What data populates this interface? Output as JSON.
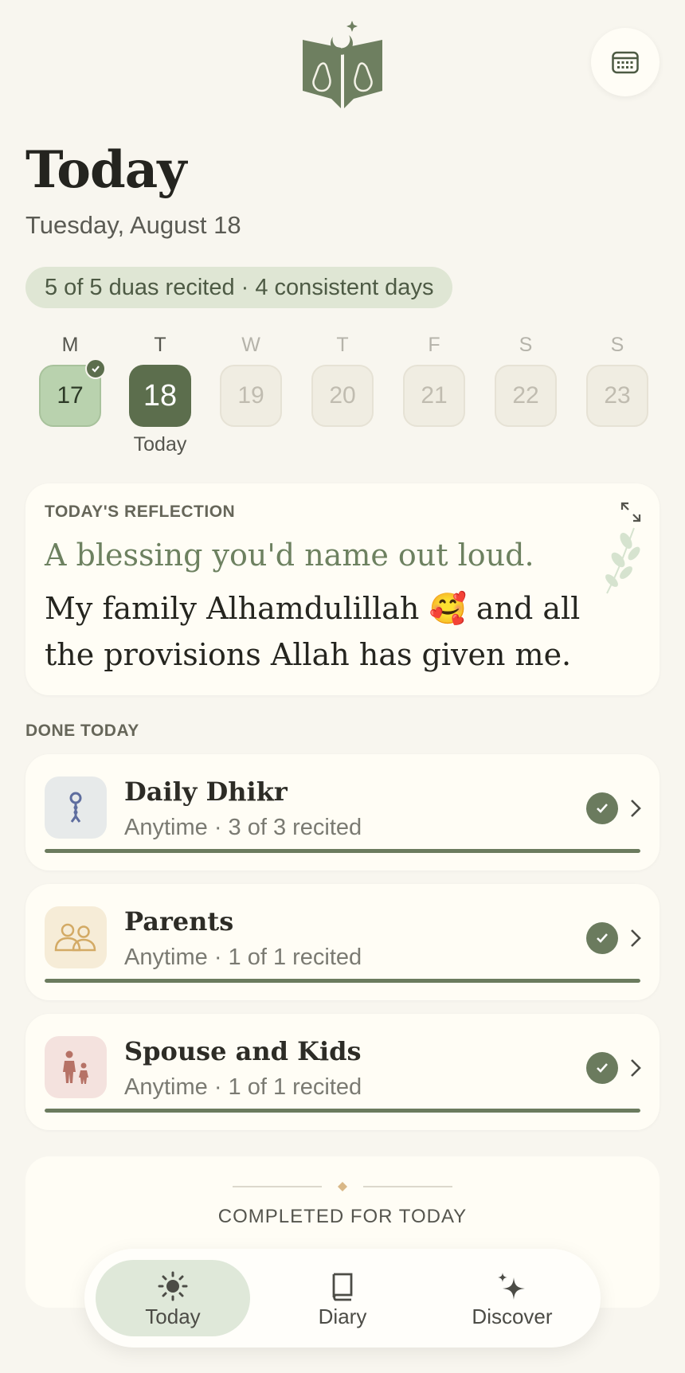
{
  "header": {
    "title": "Today",
    "date": "Tuesday, August 18",
    "stats": "5 of 5 duas recited · 4 consistent days"
  },
  "week": {
    "days": [
      {
        "letter": "M",
        "num": "17",
        "state": "done"
      },
      {
        "letter": "T",
        "num": "18",
        "state": "today",
        "sub": "Today"
      },
      {
        "letter": "W",
        "num": "19",
        "state": "future"
      },
      {
        "letter": "T",
        "num": "20",
        "state": "future"
      },
      {
        "letter": "F",
        "num": "21",
        "state": "future"
      },
      {
        "letter": "S",
        "num": "22",
        "state": "future"
      },
      {
        "letter": "S",
        "num": "23",
        "state": "future"
      }
    ]
  },
  "reflection": {
    "label": "TODAY'S REFLECTION",
    "prompt": "A blessing you'd name out loud.",
    "answer": "My family Alhamdulillah 🥰 and all the provisions Allah has given me."
  },
  "done_section": {
    "title": "DONE TODAY",
    "items": [
      {
        "name": "Daily Dhikr",
        "meta": "Anytime · 3 of 3 recited",
        "icon": "prayer-beads-icon",
        "progress": 1.0
      },
      {
        "name": "Parents",
        "meta": "Anytime · 1 of 1 recited",
        "icon": "parents-icon",
        "progress": 1.0
      },
      {
        "name": "Spouse and Kids",
        "meta": "Anytime · 1 of 1 recited",
        "icon": "parent-child-icon",
        "progress": 1.0
      }
    ]
  },
  "completed": {
    "text": "COMPLETED FOR TODAY"
  },
  "nav": {
    "today": "Today",
    "diary": "Diary",
    "discover": "Discover"
  },
  "colors": {
    "background": "#f8f6ef",
    "accent": "#5c6e4d",
    "card": "#fffdf5",
    "pill": "#dfe6d4"
  }
}
